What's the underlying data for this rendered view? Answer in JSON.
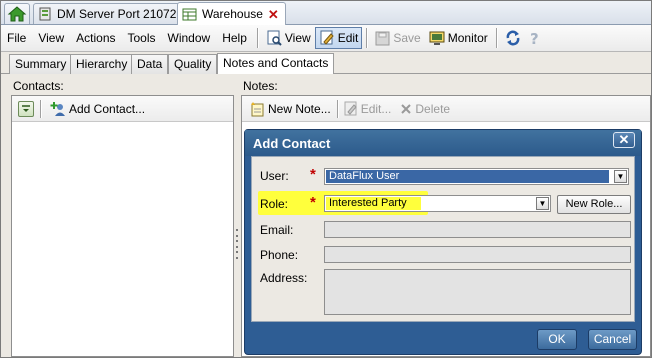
{
  "doc_tabs": [
    {
      "label": "DM Server Port 21072"
    },
    {
      "label": "Warehouse"
    }
  ],
  "menu": [
    "File",
    "View",
    "Actions",
    "Tools",
    "Window",
    "Help"
  ],
  "toolbar": {
    "view": "View",
    "edit": "Edit",
    "save": "Save",
    "monitor": "Monitor"
  },
  "view_tabs": [
    "Summary",
    "Hierarchy",
    "Data",
    "Quality",
    "Notes and Contacts"
  ],
  "contacts": {
    "label": "Contacts:",
    "add_contact": "Add Contact..."
  },
  "notes": {
    "label": "Notes:",
    "new_note": "New Note...",
    "edit": "Edit...",
    "delete": "Delete"
  },
  "dialog": {
    "title": "Add Contact",
    "close": "✕",
    "user_label": "User:",
    "user_value": "DataFlux User",
    "role_label": "Role:",
    "role_value": "Interested Party",
    "new_role": "New Role...",
    "email_label": "Email:",
    "phone_label": "Phone:",
    "address_label": "Address:",
    "ok": "OK",
    "cancel": "Cancel",
    "required_mark": "*"
  },
  "colors": {
    "dialog_blue": "#2e5d94",
    "highlight": "#ffff3c",
    "selection": "#3a67a5",
    "required": "#c00000"
  }
}
